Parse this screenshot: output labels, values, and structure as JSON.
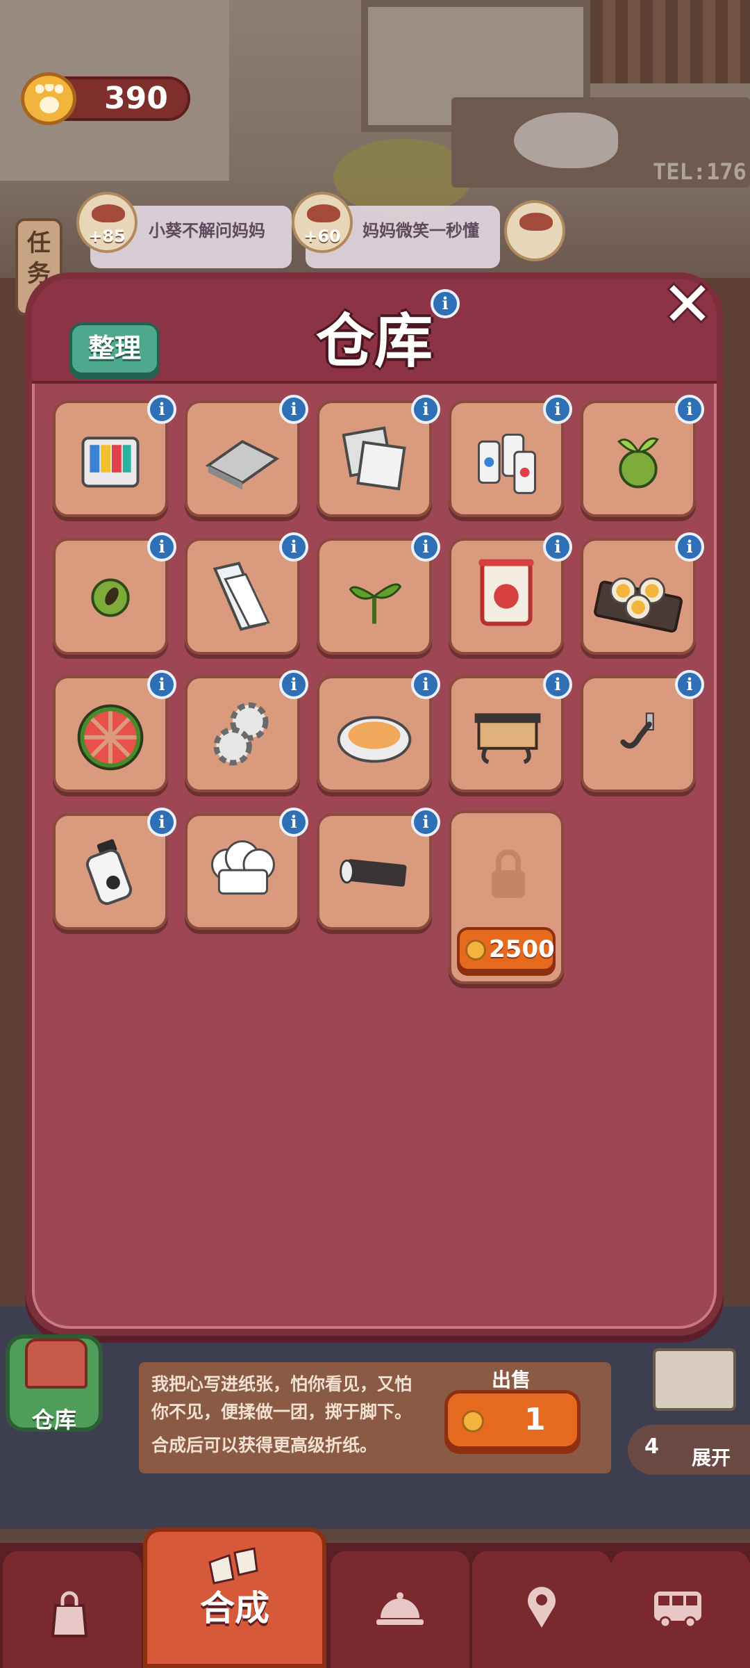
{
  "currency": {
    "paws": "390"
  },
  "tasks": {
    "tab_label": "任务",
    "cards": [
      {
        "reward": "+85",
        "title": "小葵不解问妈妈"
      },
      {
        "reward": "+60",
        "title": "妈妈微笑一秒懂"
      }
    ]
  },
  "background": {
    "shop_phone": "TEL:176"
  },
  "warehouse": {
    "title": "仓库",
    "sort_label": "整理",
    "close_symbol": "✕",
    "info_symbol": "i",
    "items": [
      "printer-ink-icon",
      "metal-plate-icon",
      "glass-plates-icon",
      "bottles-icon",
      "seedling-icon",
      "seed-icon",
      "paper-strips-icon",
      "tea-leaf-icon",
      "tea-scroll-icon",
      "pudding-tray-icon",
      "watermelon-slices-icon",
      "gears-icon",
      "soup-bowl-icon",
      "wall-shelf-icon",
      "wall-hook-icon",
      "medicine-bottle-icon",
      "chef-hat-icon",
      "rolled-bar-icon"
    ],
    "locked_slot": {
      "price": "2500"
    }
  },
  "footer": {
    "warehouse_label": "仓库",
    "description_lines": [
      "我把心写进纸张，怕你看见，又怕",
      "你不见，便揉做一团，掷于脚下。"
    ],
    "hint": "合成后可以获得更高级折纸。",
    "sell_label": "出售",
    "sell_value": "1",
    "expand_count": "4",
    "expand_label": "展开"
  },
  "nav": {
    "items": [
      {
        "name": "bag-icon"
      },
      {
        "name": "merge-tab",
        "label": "合成",
        "active": true
      },
      {
        "name": "service-bell-icon"
      },
      {
        "name": "map-pin-icon"
      },
      {
        "name": "bus-icon"
      }
    ]
  },
  "colors": {
    "modal_bg": "#9e4654",
    "slot_bg": "#d99a7e",
    "info_blue": "#2f6fb5",
    "sort_green": "#4ea88e",
    "sell_orange": "#e66a1e"
  }
}
